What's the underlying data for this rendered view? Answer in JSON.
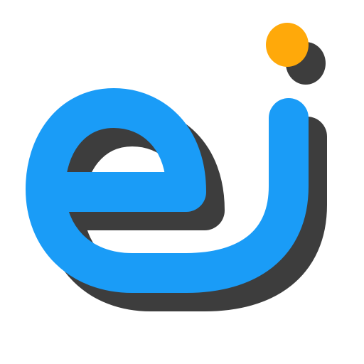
{
  "logo": {
    "icon": "ej-logo-icon",
    "colors": {
      "primary": "#1a9cf7",
      "shadow": "#3d3d3d",
      "accent_dot": "#ffa90a",
      "background": "#ffffff"
    }
  }
}
